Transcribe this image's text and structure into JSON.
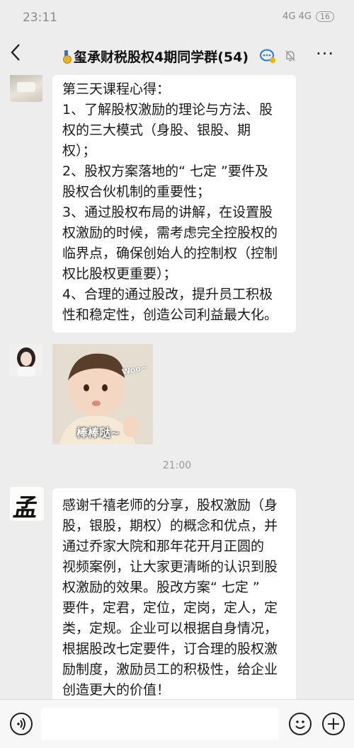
{
  "status_bar": {
    "time": "23:11",
    "network": "4G  4G",
    "battery": "16"
  },
  "header": {
    "back_icon": "back-arrow-icon",
    "title": "玺承财税股权4期同学群(54)",
    "more": "···"
  },
  "messages": [
    {
      "type": "text",
      "lines": [
        "第三天课程心得：",
        "1、了解股权激励的理论与方法、股",
        "权的三大模式（身股、银股、期",
        "权）；",
        "2、股权方案落地的“ 七定 ”要件及",
        "股权合伙机制的重要性；",
        "3、通过股权布局的讲解，在设置股",
        "权激励的时候，需考虑完全控股权的",
        "临界点，确保创始人的控制权（控制",
        "权比股权更重要）；",
        "4、合理的通过股改，提升员工积极",
        "性和稳定性，创造公司利益最大化。"
      ]
    },
    {
      "type": "sticker",
      "caption_top": "Woo~",
      "caption_bottom": "棒棒哒~"
    },
    {
      "type": "timestamp",
      "text": "21:00"
    },
    {
      "type": "text",
      "lines": [
        "感谢千禧老师的分享，股权激励（身",
        "股，银股，期权）的概念和优点，并",
        "通过乔家大院和那年花开月正圆的",
        "视频案例，让大家更清晰的认识到股",
        "权激励的效果。股改方案“ 七定 ”",
        "要件，定君，定位，定岗，定人，定",
        "类，定规。企业可以根据自身情况，",
        "根据股改七定要件，订合理的股权激",
        "励制度，激励员工的积极性，给企业",
        "创造更大的价值！"
      ]
    }
  ],
  "avatar3_text": "孟",
  "input_bar": {
    "voice_icon": "voice-icon",
    "emoji_icon": "emoji-icon",
    "plus_icon": "plus-icon"
  }
}
